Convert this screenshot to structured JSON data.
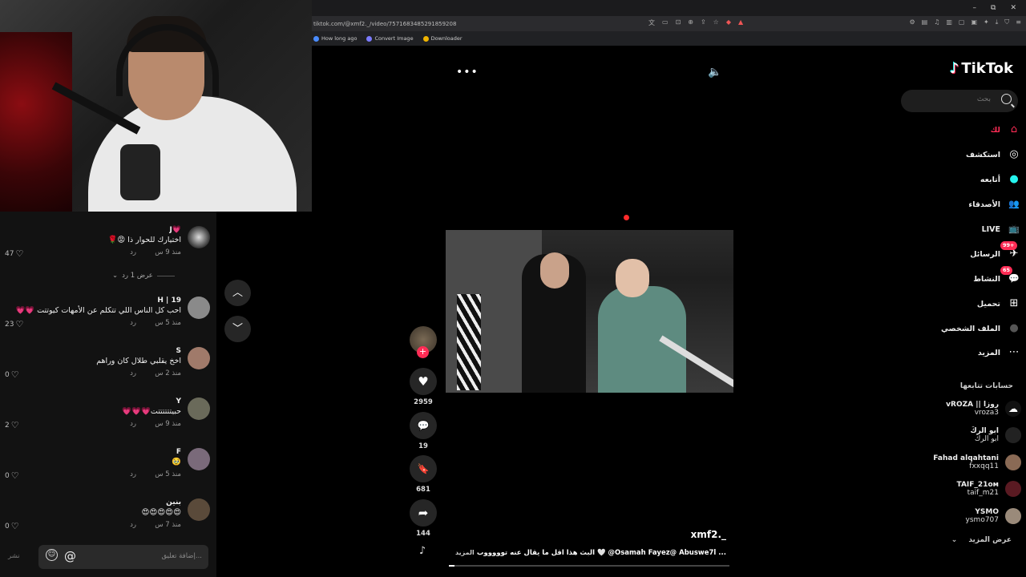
{
  "browser": {
    "url": "tiktok.com/@xmf2._/video/7571683485291859208",
    "bookmarks": [
      {
        "label": "How long ago",
        "color": "#4a8cff"
      },
      {
        "label": "Convert Image",
        "color": "#7b7bff"
      },
      {
        "label": "Downloader",
        "color": "#f0b400"
      }
    ],
    "window_controls": [
      "–",
      "⧉",
      "✕"
    ]
  },
  "chat": {
    "comments": [
      {
        "user": "J💗",
        "text": "اختيارك للحوار ذا 😡🌹",
        "time": "منذ 9 س",
        "reply": "رد",
        "likes": "47"
      },
      {
        "user": "H | 19",
        "text": "احب كل الناس اللي تتكلم عن الأمهات كيوتتت 💗💗",
        "time": "منذ 5 س",
        "reply": "رد",
        "likes": "23"
      },
      {
        "user": "S",
        "text": "اخخ يقلبي طلال كان وراهم",
        "time": "منذ 2 س",
        "reply": "رد",
        "likes": "0"
      },
      {
        "user": "Y",
        "text": "حبيتتتتتتت💗💗💗",
        "time": "منذ 9 س",
        "reply": "رد",
        "likes": "2"
      },
      {
        "user": "F",
        "text": "🥹",
        "time": "منذ 5 س",
        "reply": "رد",
        "likes": "0"
      },
      {
        "user": "بنين",
        "text": "😍😍😍😍😍",
        "time": "منذ 7 س",
        "reply": "رد",
        "likes": "0"
      }
    ],
    "view_replies": "عرض 1 رد",
    "input_placeholder": "إضافة تعليق...",
    "post_label": "نشر"
  },
  "video": {
    "actions": [
      {
        "icon": "heart-icon",
        "glyph": "♥",
        "count": "2959"
      },
      {
        "icon": "comment-icon",
        "glyph": "💬",
        "count": "19"
      },
      {
        "icon": "bookmark-icon",
        "glyph": "🔖",
        "count": "681"
      },
      {
        "icon": "share-icon",
        "glyph": "➦",
        "count": "144"
      }
    ],
    "author": "xmf2._",
    "caption": "البث هذا اقل ما يقال عنه توووووب 🤍 @Osamah Fayez@ Abuswe7l ...",
    "more_label": "المزيد",
    "progress": 0.02
  },
  "sidebar": {
    "logo": "TikTok",
    "search_placeholder": "بحث",
    "nav": [
      {
        "label": "لك",
        "icon": "home-icon",
        "glyph": "⌂",
        "active": true
      },
      {
        "label": "استكشف",
        "icon": "compass-icon",
        "glyph": "◎"
      },
      {
        "label": "أتابعه",
        "icon": "following-icon",
        "glyph": "●"
      },
      {
        "label": "الأصدقاء",
        "icon": "friends-icon",
        "glyph": "👥"
      },
      {
        "label": "LIVE",
        "icon": "live-icon",
        "glyph": "📺"
      },
      {
        "label": "الرسائل",
        "icon": "messages-icon",
        "glyph": "✈",
        "badge": "99+"
      },
      {
        "label": "النشاط",
        "icon": "activity-icon",
        "glyph": "💬",
        "badge": "65"
      },
      {
        "label": "تحميل",
        "icon": "upload-icon",
        "glyph": "⊞"
      },
      {
        "label": "الملف الشخصي",
        "icon": "profile-icon",
        "glyph": "●"
      },
      {
        "label": "المزيد",
        "icon": "more-icon",
        "glyph": "⋯"
      }
    ],
    "following_title": "حسابات تتابعها",
    "following": [
      {
        "name": "vROZA || روزا",
        "handle": "vroza3"
      },
      {
        "name": "ابو الركَ",
        "handle": "ابو الركَ"
      },
      {
        "name": "Fahad alqahtani",
        "handle": "fxxqq11"
      },
      {
        "name": "TAIF_21ᴏᴍ",
        "handle": "taif_m21"
      },
      {
        "name": "YSMO",
        "handle": "ysmo707"
      }
    ],
    "show_more": "عرض المزيد"
  }
}
